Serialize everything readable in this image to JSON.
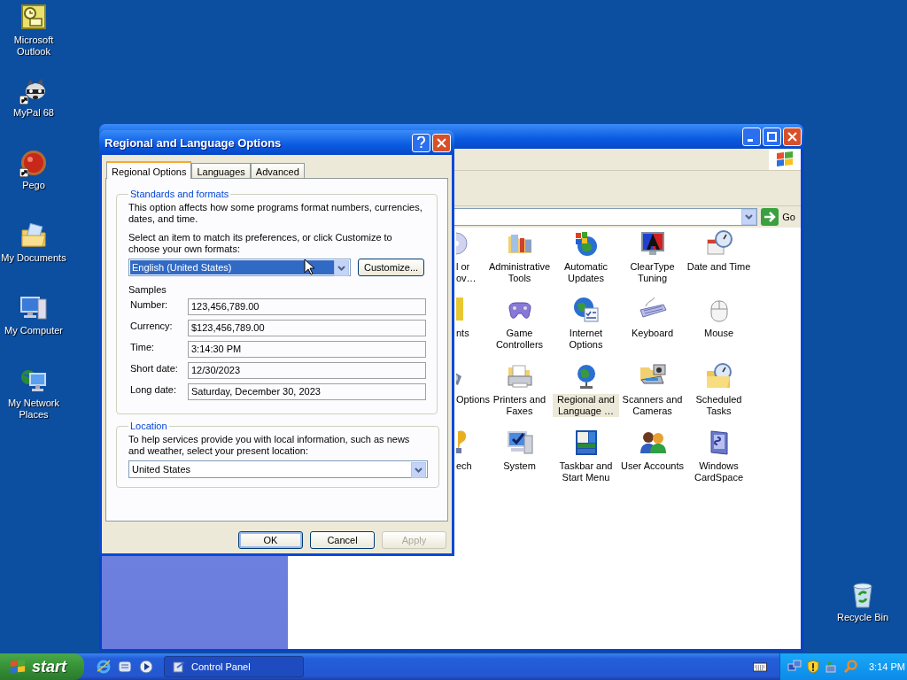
{
  "desktop_icons": [
    {
      "label": "Microsoft Outlook",
      "shortcut": false
    },
    {
      "label": "MyPal 68",
      "shortcut": true
    },
    {
      "label": "Pego",
      "shortcut": true
    },
    {
      "label": "My Documents",
      "shortcut": false
    },
    {
      "label": "My Computer",
      "shortcut": false
    },
    {
      "label": "My Network Places",
      "shortcut": false
    }
  ],
  "recycle_bin": {
    "label": "Recycle Bin"
  },
  "control_panel": {
    "go_button": "Go",
    "items": [
      {
        "label": "l or ov…",
        "kind": "partial",
        "selected": false
      },
      {
        "label": "Administrative Tools",
        "kind": "full",
        "selected": false
      },
      {
        "label": "Automatic Updates",
        "kind": "full",
        "selected": false
      },
      {
        "label": "ClearType Tuning",
        "kind": "full",
        "selected": false
      },
      {
        "label": "Date and Time",
        "kind": "full",
        "selected": false
      },
      {
        "label": "nts",
        "kind": "partial",
        "selected": false
      },
      {
        "label": "Game Controllers",
        "kind": "full",
        "selected": false
      },
      {
        "label": "Internet Options",
        "kind": "full",
        "selected": false
      },
      {
        "label": "Keyboard",
        "kind": "full",
        "selected": false
      },
      {
        "label": "Mouse",
        "kind": "full",
        "selected": false
      },
      {
        "label": "Options",
        "kind": "partial",
        "selected": false
      },
      {
        "label": "Printers and Faxes",
        "kind": "full",
        "selected": false
      },
      {
        "label": "Regional and Language …",
        "kind": "full",
        "selected": true
      },
      {
        "label": "Scanners and Cameras",
        "kind": "full",
        "selected": false
      },
      {
        "label": "Scheduled Tasks",
        "kind": "full",
        "selected": false
      },
      {
        "label": "ech",
        "kind": "partial",
        "selected": false
      },
      {
        "label": "System",
        "kind": "full",
        "selected": false
      },
      {
        "label": "Taskbar and Start Menu",
        "kind": "full",
        "selected": false
      },
      {
        "label": "User Accounts",
        "kind": "full",
        "selected": false
      },
      {
        "label": "Windows CardSpace",
        "kind": "full",
        "selected": false
      }
    ]
  },
  "dialog": {
    "title": "Regional and Language Options",
    "tabs": [
      {
        "label": "Regional Options",
        "selected": true
      },
      {
        "label": "Languages",
        "selected": false
      },
      {
        "label": "Advanced",
        "selected": false
      }
    ],
    "standards": {
      "title": "Standards and formats",
      "description": "This option affects how some programs format numbers, currencies, dates, and time.",
      "prompt": "Select an item to match its preferences, or click Customize to choose your own formats:",
      "format": "English (United States)",
      "customize_button": "Customize...",
      "samples_title": "Samples",
      "samples": [
        {
          "label": "Number:",
          "value": "123,456,789.00"
        },
        {
          "label": "Currency:",
          "value": "$123,456,789.00"
        },
        {
          "label": "Time:",
          "value": "3:14:30 PM"
        },
        {
          "label": "Short date:",
          "value": "12/30/2023"
        },
        {
          "label": "Long date:",
          "value": "Saturday, December 30, 2023"
        }
      ]
    },
    "location": {
      "title": "Location",
      "description": "To help services provide you with local information, such as news and weather, select your present location:",
      "value": "United States"
    },
    "buttons": [
      {
        "label": "OK",
        "default": true,
        "disabled": false
      },
      {
        "label": "Cancel",
        "default": false,
        "disabled": false
      },
      {
        "label": "Apply",
        "default": false,
        "disabled": true
      }
    ]
  },
  "taskbar": {
    "start": "start",
    "tasks": [
      {
        "label": "Control Panel"
      }
    ],
    "clock": "3:14 PM"
  }
}
